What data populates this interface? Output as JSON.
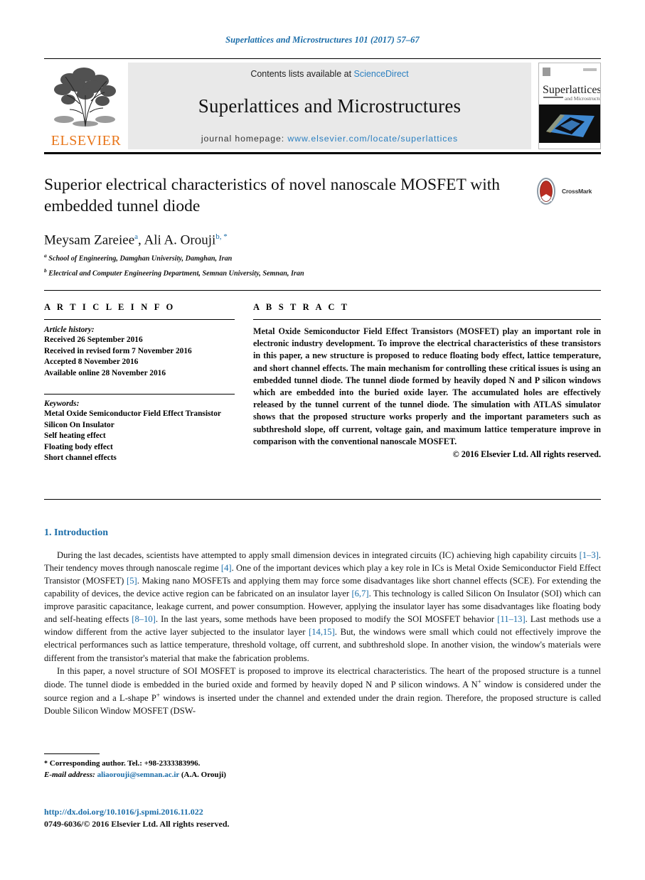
{
  "running_head": "Superlattices and Microstructures 101 (2017) 57–67",
  "masthead": {
    "publisher_name": "ELSEVIER",
    "publisher_logo_icon": "elsevier-tree-logo",
    "contents_prefix": "Contents lists available at",
    "contents_link": "ScienceDirect",
    "journal_title": "Superlattices and Microstructures",
    "homepage_label": "journal homepage:",
    "homepage_url": "www.elsevier.com/locate/superlattices",
    "cover_title": "Superlattices",
    "cover_subtitle": "and Microstructures"
  },
  "article": {
    "title": "Superior electrical characteristics of novel nanoscale MOSFET with embedded tunnel diode",
    "crossmark_label": "CrossMark",
    "crossmark_icon": "crossmark-badge-icon",
    "authors": [
      {
        "name": "Meysam Zareiee",
        "marker": "a"
      },
      {
        "name": "Ali A. Orouji",
        "marker": "b, *"
      }
    ],
    "authors_separator": ", ",
    "affiliations": [
      {
        "marker": "a",
        "text": "School of Engineering, Damghan University, Damghan, Iran"
      },
      {
        "marker": "b",
        "text": "Electrical and Computer Engineering Department, Semnan University, Semnan, Iran"
      }
    ]
  },
  "article_info": {
    "heading": "A R T I C L E   I N F O",
    "history_label": "Article history:",
    "history": [
      "Received 26 September 2016",
      "Received in revised form 7 November 2016",
      "Accepted 8 November 2016",
      "Available online 28 November 2016"
    ],
    "keywords_label": "Keywords:",
    "keywords": [
      "Metal Oxide Semiconductor Field Effect Transistor",
      "Silicon On Insulator",
      "Self heating effect",
      "Floating body effect",
      "Short channel effects"
    ]
  },
  "abstract": {
    "heading": "A B S T R A C T",
    "text": "Metal Oxide Semiconductor Field Effect Transistors (MOSFET) play an important role in electronic industry development. To improve the electrical characteristics of these transistors in this paper, a new structure is proposed to reduce floating body effect, lattice temperature, and short channel effects. The main mechanism for controlling these critical issues is using an embedded tunnel diode. The tunnel diode formed by heavily doped N and P silicon windows which are embedded into the buried oxide layer. The accumulated holes are effectively released by the tunnel current of the tunnel diode. The simulation with ATLAS simulator shows that the proposed structure works properly and the important parameters such as subthreshold slope, off current, voltage gain, and maximum lattice temperature improve in comparison with the conventional nanoscale MOSFET.",
    "copyright": "© 2016 Elsevier Ltd. All rights reserved."
  },
  "body": {
    "section_number_title": "1. Introduction",
    "paragraph_1": {
      "part_1": "During the last decades, scientists have attempted to apply small dimension devices in integrated circuits (IC) achieving high capability circuits ",
      "cite_1": "[1–3]",
      "part_2": ". Their tendency moves through nanoscale regime ",
      "cite_2": "[4]",
      "part_3": ". One of the important devices which play a key role in ICs is Metal Oxide Semiconductor Field Effect Transistor (MOSFET) ",
      "cite_3": "[5]",
      "part_4": ". Making nano MOSFETs and applying them may force some disadvantages like short channel effects (SCE). For extending the capability of devices, the device active region can be fabricated on an insulator layer ",
      "cite_4": "[6,7]",
      "part_5": ". This technology is called Silicon On Insulator (SOI) which can improve parasitic capacitance, leakage current, and power consumption. However, applying the insulator layer has some disadvantages like floating body and self-heating effects ",
      "cite_5": "[8–10]",
      "part_6": ". In the last years, some methods have been proposed to modify the SOI MOSFET behavior ",
      "cite_6": "[11–13]",
      "part_7": ". Last methods use a window different from the active layer subjected to the insulator layer ",
      "cite_7": "[14,15]",
      "part_8": ". But, the windows were small which could not effectively improve the electrical performances such as lattice temperature, threshold voltage, off current, and subthreshold slope. In another vision, the window's materials were different from the transistor's material that make the fabrication problems."
    },
    "paragraph_2": {
      "part_1": "In this paper, a novel structure of SOI MOSFET is proposed to improve its electrical characteristics. The heart of the proposed structure is a tunnel diode. The tunnel diode is embedded in the buried oxide and formed by heavily doped N and P silicon windows. A N",
      "sup_1": "+",
      "part_2": " window is considered under the source region and a L-shape P",
      "sup_2": "+",
      "part_3": " windows is inserted under the channel and extended under the drain region. Therefore, the proposed structure is called Double Silicon Window MOSFET (DSW-"
    }
  },
  "footer": {
    "corresponding_marker": "*",
    "corresponding_text": "Corresponding author. Tel.: +98-2333383996.",
    "email_label": "E-mail address:",
    "email": "aliaorouji@semnan.ac.ir",
    "email_owner": "(A.A. Orouji)",
    "doi_url": "http://dx.doi.org/10.1016/j.spmi.2016.11.022",
    "issn_line": "0749-6036/© 2016 Elsevier Ltd. All rights reserved."
  },
  "colors": {
    "link_blue": "#1a6ca8",
    "sciencedirect_blue": "#2a7fc0",
    "elsevier_orange": "#e8761b",
    "masthead_grey": "#e9e9e9"
  }
}
